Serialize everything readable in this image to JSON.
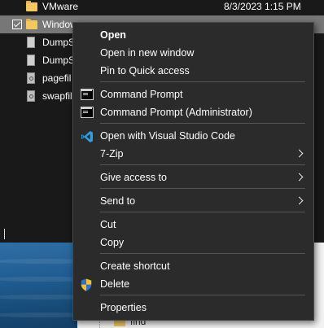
{
  "explorer": {
    "files": [
      {
        "name": "VMware",
        "date": "8/3/2023 1:15 PM",
        "type": "folder",
        "selected": false
      },
      {
        "name": "Window",
        "date": "",
        "type": "folder",
        "selected": true
      },
      {
        "name": "DumpS",
        "date": "",
        "type": "doc",
        "selected": false
      },
      {
        "name": "DumpS",
        "date": "",
        "type": "doc",
        "selected": false
      },
      {
        "name": "pagefil",
        "date": "",
        "type": "sys",
        "selected": false
      },
      {
        "name": "swapfil",
        "date": "",
        "type": "sys",
        "selected": false
      }
    ]
  },
  "behind_window": {
    "folder_label": "find"
  },
  "context_menu": {
    "items": [
      {
        "label": "Open",
        "bold": true
      },
      {
        "label": "Open in new window"
      },
      {
        "label": "Pin to Quick access"
      },
      {
        "label": "Command Prompt",
        "icon": "command-prompt-icon"
      },
      {
        "label": "Command Prompt (Administrator)",
        "icon": "command-prompt-icon"
      },
      {
        "label": "Open with Visual Studio Code",
        "icon": "vscode-icon"
      },
      {
        "label": "7-Zip",
        "submenu": true
      },
      {
        "label": "Give access to",
        "submenu": true
      },
      {
        "label": "Send to",
        "submenu": true
      },
      {
        "label": "Cut"
      },
      {
        "label": "Copy"
      },
      {
        "label": "Create shortcut"
      },
      {
        "label": "Delete",
        "icon": "uac-shield-icon"
      },
      {
        "label": "Properties"
      }
    ]
  },
  "colors": {
    "menu_background": "#2b2b2b",
    "explorer_background": "#191919",
    "selected_row": "#777777",
    "folder": "#f5c85b"
  }
}
